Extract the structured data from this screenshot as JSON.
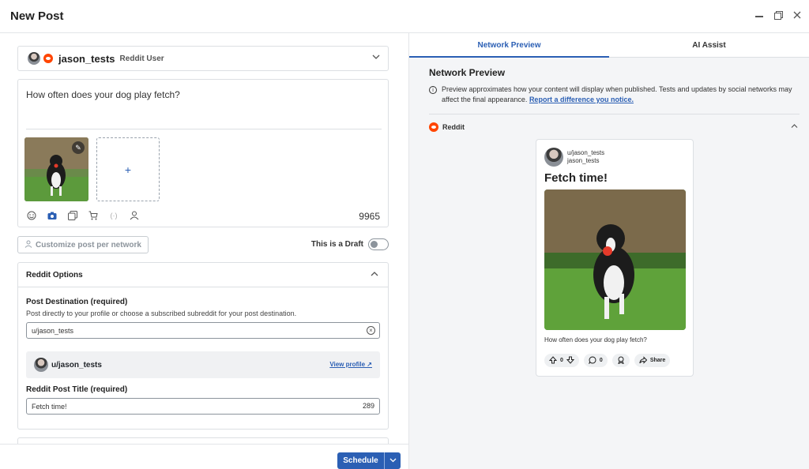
{
  "window": {
    "title": "New Post"
  },
  "account": {
    "name": "jason_tests",
    "type": "Reddit User"
  },
  "composer": {
    "text": "How often does your dog play fetch?",
    "add_label": "+",
    "char_count": "9965"
  },
  "customize": {
    "label": "Customize post per network"
  },
  "draft": {
    "label": "This is a Draft",
    "enabled": false
  },
  "reddit_options": {
    "header": "Reddit Options",
    "destination_label": "Post Destination (required)",
    "destination_help": "Post directly to your profile or choose a subscribed subreddit for your post destination.",
    "destination_value": "u/jason_tests",
    "profile_name": "u/jason_tests",
    "view_profile": "View profile ↗",
    "title_label": "Reddit Post Title (required)",
    "title_value": "Fetch time!",
    "title_remaining": "289"
  },
  "footer": {
    "schedule_label": "Schedule"
  },
  "tabs": [
    {
      "label": "Network Preview",
      "active": true
    },
    {
      "label": "AI Assist",
      "active": false
    }
  ],
  "preview": {
    "heading": "Network Preview",
    "info_text": "Preview approximates how your content will display when published. Tests and updates by social networks may affect the final appearance.",
    "info_link": "Report a difference you notice.",
    "network": "Reddit",
    "post": {
      "username": "u/jason_tests",
      "display_name": "jason_tests",
      "title": "Fetch time!",
      "body": "How often does your dog play fetch?",
      "votes": "0",
      "comments": "0",
      "share": "Share"
    }
  },
  "colors": {
    "accent": "#2b5fb4",
    "reddit": "#ff4500"
  }
}
